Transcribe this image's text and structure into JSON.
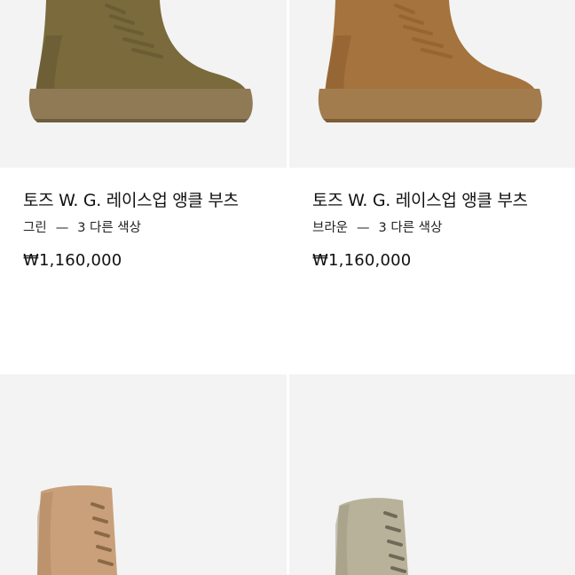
{
  "products": [
    {
      "title": "토즈 W. G. 레이스업 앵클 부츠",
      "color": "그린",
      "dash": "—",
      "variants": "3 다른 색상",
      "price": "₩1,160,000",
      "suede": "#7a6a3c",
      "suede_dark": "#5f5230",
      "sole": "#8f7a55",
      "lace": "#6b5d33"
    },
    {
      "title": "토즈 W. G. 레이스업 앵클 부츠",
      "color": "브라운",
      "dash": "—",
      "variants": "3 다른 색상",
      "price": "₩1,160,000",
      "suede": "#a5733d",
      "suede_dark": "#85592c",
      "sole": "#a37c4e",
      "lace": "#94672f"
    },
    {
      "suede": "#c9a07a",
      "suede_dark": "#b08560",
      "lace": "#8a6a45"
    },
    {
      "suede": "#b9b29a",
      "suede_dark": "#9c967e",
      "lace": "#6f6a57"
    }
  ]
}
